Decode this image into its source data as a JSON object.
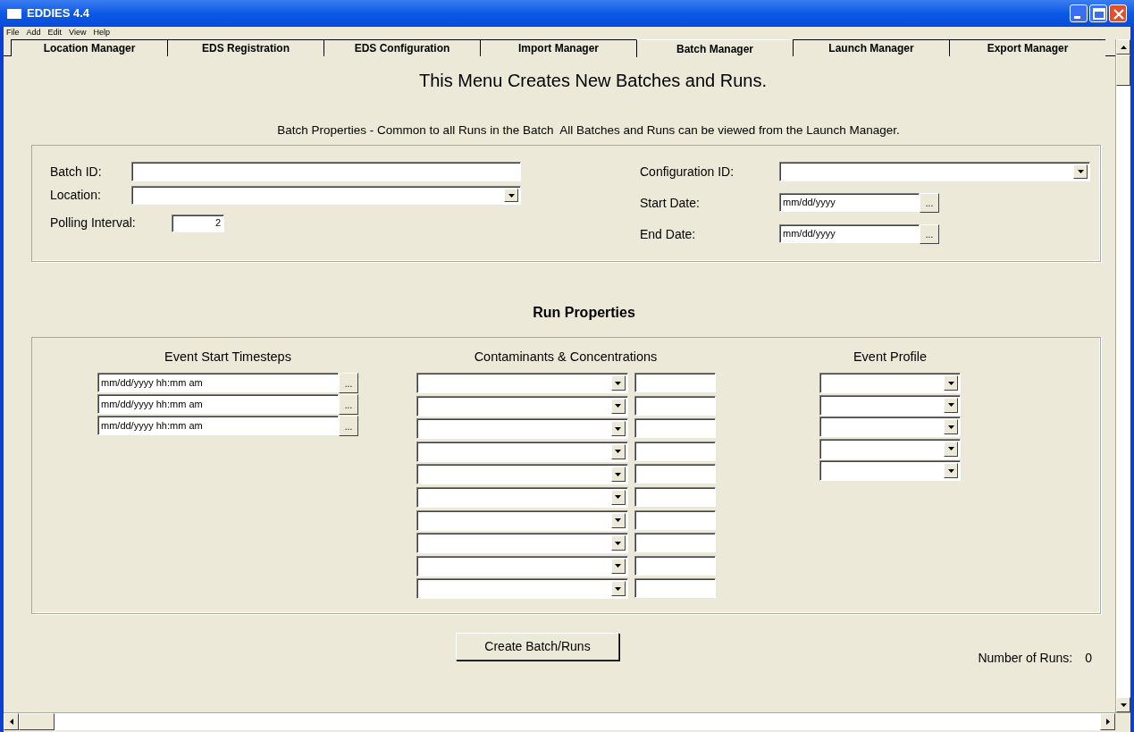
{
  "window": {
    "title": "EDDIES 4.4"
  },
  "menu": [
    "File",
    "Add",
    "Edit",
    "View",
    "Help"
  ],
  "tabs": [
    {
      "label": "Location Manager",
      "selected": false
    },
    {
      "label": "EDS Registration",
      "selected": false
    },
    {
      "label": "EDS Configuration",
      "selected": false
    },
    {
      "label": "Import Manager",
      "selected": false
    },
    {
      "label": "Batch Manager",
      "selected": true
    },
    {
      "label": "Launch Manager",
      "selected": false
    },
    {
      "label": "Export Manager",
      "selected": false
    }
  ],
  "heading": "This Menu Creates New Batches and Runs.",
  "subtitle": "Batch Properties - Common to all Runs in the Batch  All Batches and Runs can be viewed from the Launch Manager.",
  "batch_properties": {
    "batch_id": {
      "label": "Batch ID:"
    },
    "location": {
      "label": "Location:"
    },
    "polling_interval": {
      "label": "Polling Interval:",
      "value": "2"
    },
    "configuration_id": {
      "label": "Configuration ID:"
    },
    "start_date": {
      "label": "Start Date:",
      "value": "mm/dd/yyyy",
      "button": "..."
    },
    "end_date": {
      "label": "End Date:",
      "value": "mm/dd/yyyy",
      "button": "..."
    }
  },
  "run_properties": {
    "heading": "Run Properties",
    "event_start_timesteps": {
      "heading": "Event Start Timesteps",
      "rows": [
        {
          "value": "mm/dd/yyyy hh:mm am",
          "button": "..."
        },
        {
          "value": "mm/dd/yyyy hh:mm am",
          "button": "..."
        },
        {
          "value": "mm/dd/yyyy hh:mm am",
          "button": "..."
        }
      ]
    },
    "contaminants": {
      "heading": "Contaminants & Concentrations",
      "rows": [
        {
          "kind": "dropdown_with_amount"
        },
        {
          "kind": "dropdown_with_amount"
        },
        {
          "kind": "dropdown_with_amount"
        },
        {
          "kind": "dropdown_with_amount"
        },
        {
          "kind": "dropdown_with_amount"
        },
        {
          "kind": "dropdown_with_amount"
        },
        {
          "kind": "dropdown_with_amount"
        },
        {
          "kind": "dropdown_with_amount"
        },
        {
          "kind": "dropdown_with_amount"
        },
        {
          "kind": "dropdown_with_amount"
        }
      ]
    },
    "event_profile": {
      "heading": "Event Profile",
      "rows": [
        {
          "kind": "dropdown"
        },
        {
          "kind": "dropdown"
        },
        {
          "kind": "dropdown"
        },
        {
          "kind": "dropdown"
        },
        {
          "kind": "dropdown"
        }
      ]
    }
  },
  "create_button": "Create Batch/Runs",
  "number_of_runs": {
    "label": "Number of Runs:",
    "value": "0"
  }
}
